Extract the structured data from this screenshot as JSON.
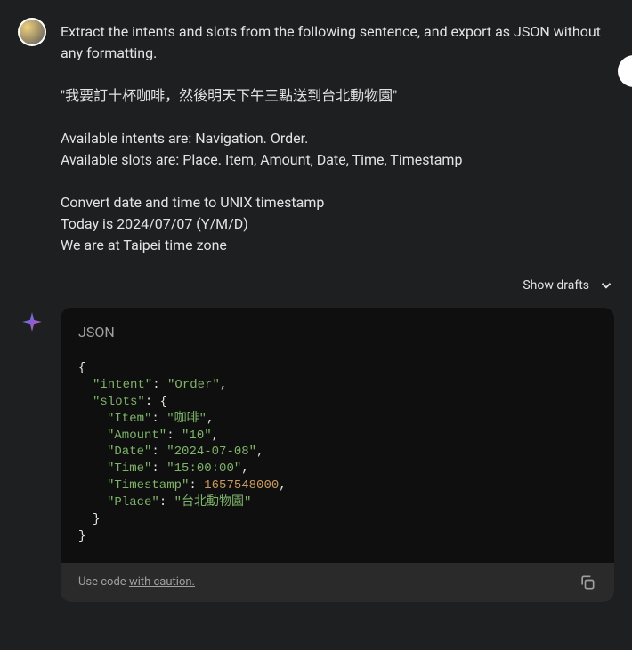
{
  "user_message": {
    "line1": "Extract the intents and slots from the following sentence, and export as JSON without any formatting.",
    "line2": "\"我要訂十杯咖啡，然後明天下午三點送到台北動物園\"",
    "line3": "Available intents are: Navigation. Order.",
    "line4": "Available slots are: Place. Item, Amount, Date, Time, Timestamp",
    "line5": "Convert date and time to UNIX timestamp",
    "line6": "Today is 2024/07/07 (Y/M/D)",
    "line7": "We are at Taipei time zone"
  },
  "show_drafts": "Show drafts",
  "code_lang": "JSON",
  "json": {
    "intent_key": "\"intent\"",
    "intent_val": "\"Order\"",
    "slots_key": "\"slots\"",
    "item_key": "\"Item\"",
    "item_val": "\"咖啡\"",
    "amount_key": "\"Amount\"",
    "amount_val": "\"10\"",
    "date_key": "\"Date\"",
    "date_val": "\"2024-07-08\"",
    "time_key": "\"Time\"",
    "time_val": "\"15:00:00\"",
    "timestamp_key": "\"Timestamp\"",
    "timestamp_val": "1657548000",
    "place_key": "\"Place\"",
    "place_val": "\"台北動物園\""
  },
  "footer": {
    "use_code": "Use code ",
    "caution": "with caution."
  }
}
